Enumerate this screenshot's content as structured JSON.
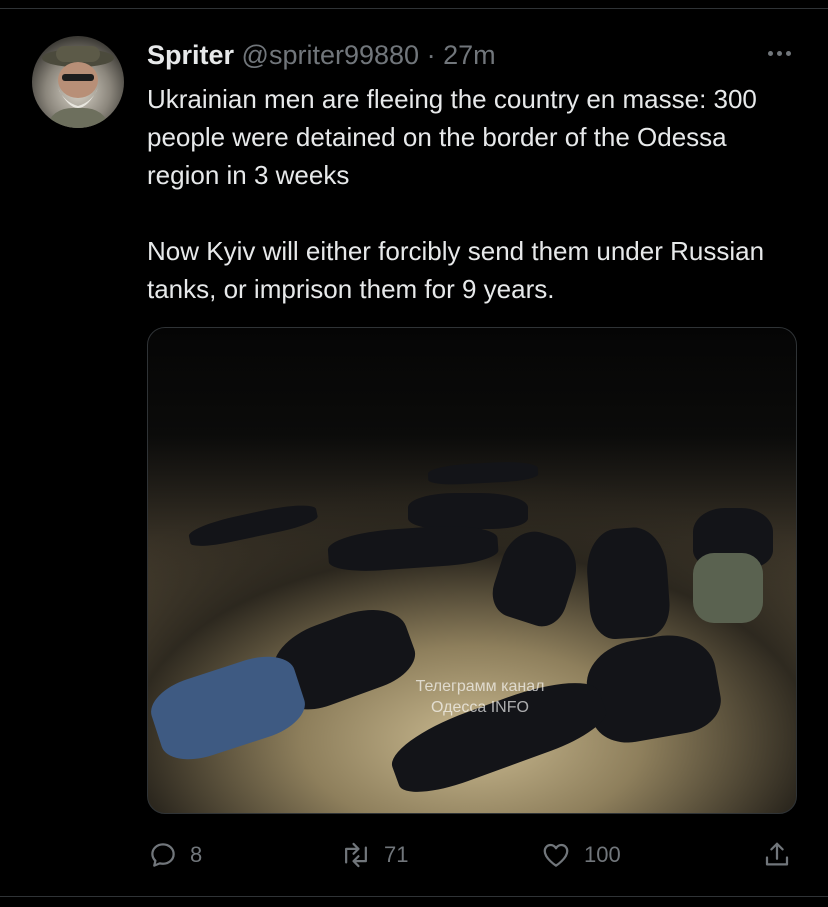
{
  "tweet": {
    "author_name": "Spriter",
    "handle": "@spriter99880",
    "separator": "·",
    "time": "27m",
    "text_paragraphs": [
      "Ukrainian men are fleeing the country en masse: 300 people were detained on the border of the Odessa region in 3 weeks",
      "Now Kyiv will either forcibly send them under Russian tanks, or imprison them for 9 years."
    ],
    "image_watermark_line1": "Телеграмм канал",
    "image_watermark_line2": "Одесса INFO"
  },
  "actions": {
    "reply_count": "8",
    "retweet_count": "71",
    "like_count": "100"
  },
  "icons": [
    "more-icon",
    "reply-icon",
    "retweet-icon",
    "like-icon",
    "share-icon"
  ],
  "colors": {
    "background": "#000000",
    "text": "#e7e9ea",
    "muted": "#71767b",
    "divider": "#2f3336"
  }
}
